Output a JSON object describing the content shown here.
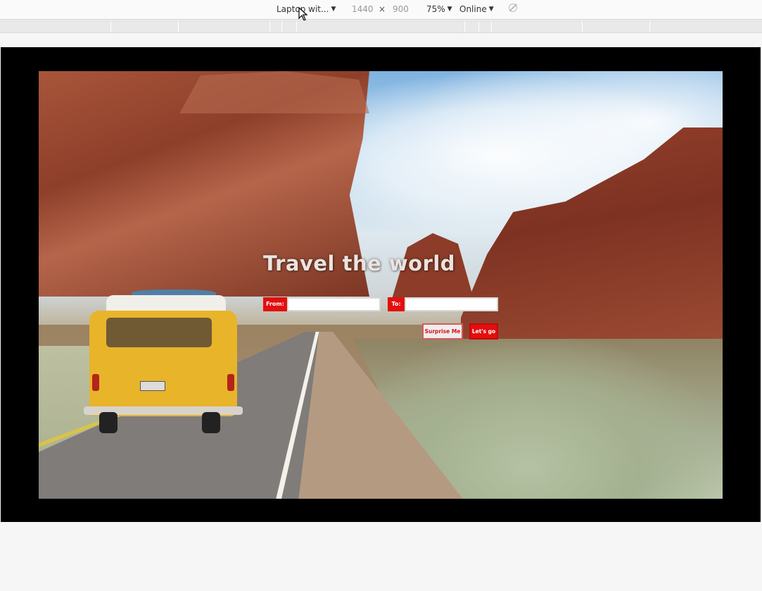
{
  "toolbar": {
    "device": "Laptop wit...",
    "width": "1440",
    "times": "×",
    "height": "900",
    "zoom": "75%",
    "network": "Online",
    "icons": {
      "rotate": "rotate-icon",
      "cursor": "mouse-cursor-icon",
      "dropdown": "caret-down-icon"
    }
  },
  "page": {
    "title": "Travel the world",
    "from_label": "From:",
    "to_label": "To:",
    "from_value": "",
    "to_value": "",
    "surprise_button": "Surprise Me",
    "go_button": "Let's go",
    "colors": {
      "accent": "#e30e0e",
      "viewport_frame": "#000000"
    },
    "background_image": "red rock canyon desert road with yellow vintage van"
  }
}
